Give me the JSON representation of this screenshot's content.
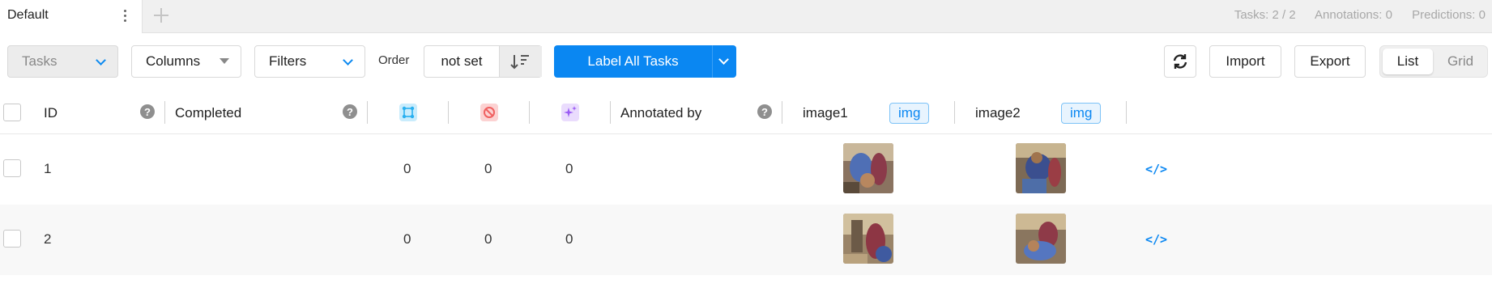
{
  "tabbar": {
    "active_tab": "Default",
    "stats": {
      "tasks": "Tasks: 2 / 2",
      "annotations": "Annotations: 0",
      "predictions": "Predictions: 0"
    }
  },
  "toolbar": {
    "tasks_label": "Tasks",
    "columns_label": "Columns",
    "filters_label": "Filters",
    "order_label": "Order",
    "order_value": "not set",
    "label_all_label": "Label All Tasks",
    "import_label": "Import",
    "export_label": "Export",
    "view_list_label": "List",
    "view_grid_label": "Grid",
    "active_view": "List"
  },
  "table": {
    "headers": {
      "id": "ID",
      "help_id": "?",
      "completed": "Completed",
      "help_completed": "?",
      "annotated_by": "Annotated by",
      "help_annotated": "?",
      "image1": "image1",
      "image1_tag": "img",
      "image2": "image2",
      "image2_tag": "img"
    },
    "rows": [
      {
        "id": "1",
        "total_annotations": "0",
        "cancelled_annotations": "0",
        "total_predictions": "0",
        "source_icon": "</>"
      },
      {
        "id": "2",
        "total_annotations": "0",
        "cancelled_annotations": "0",
        "total_predictions": "0",
        "source_icon": "</>"
      }
    ]
  },
  "colors": {
    "primary": "#0a87f2",
    "annotations_icon": "#29b0f0",
    "cancelled_icon": "#f06060",
    "predictions_icon": "#9b5cf5"
  }
}
